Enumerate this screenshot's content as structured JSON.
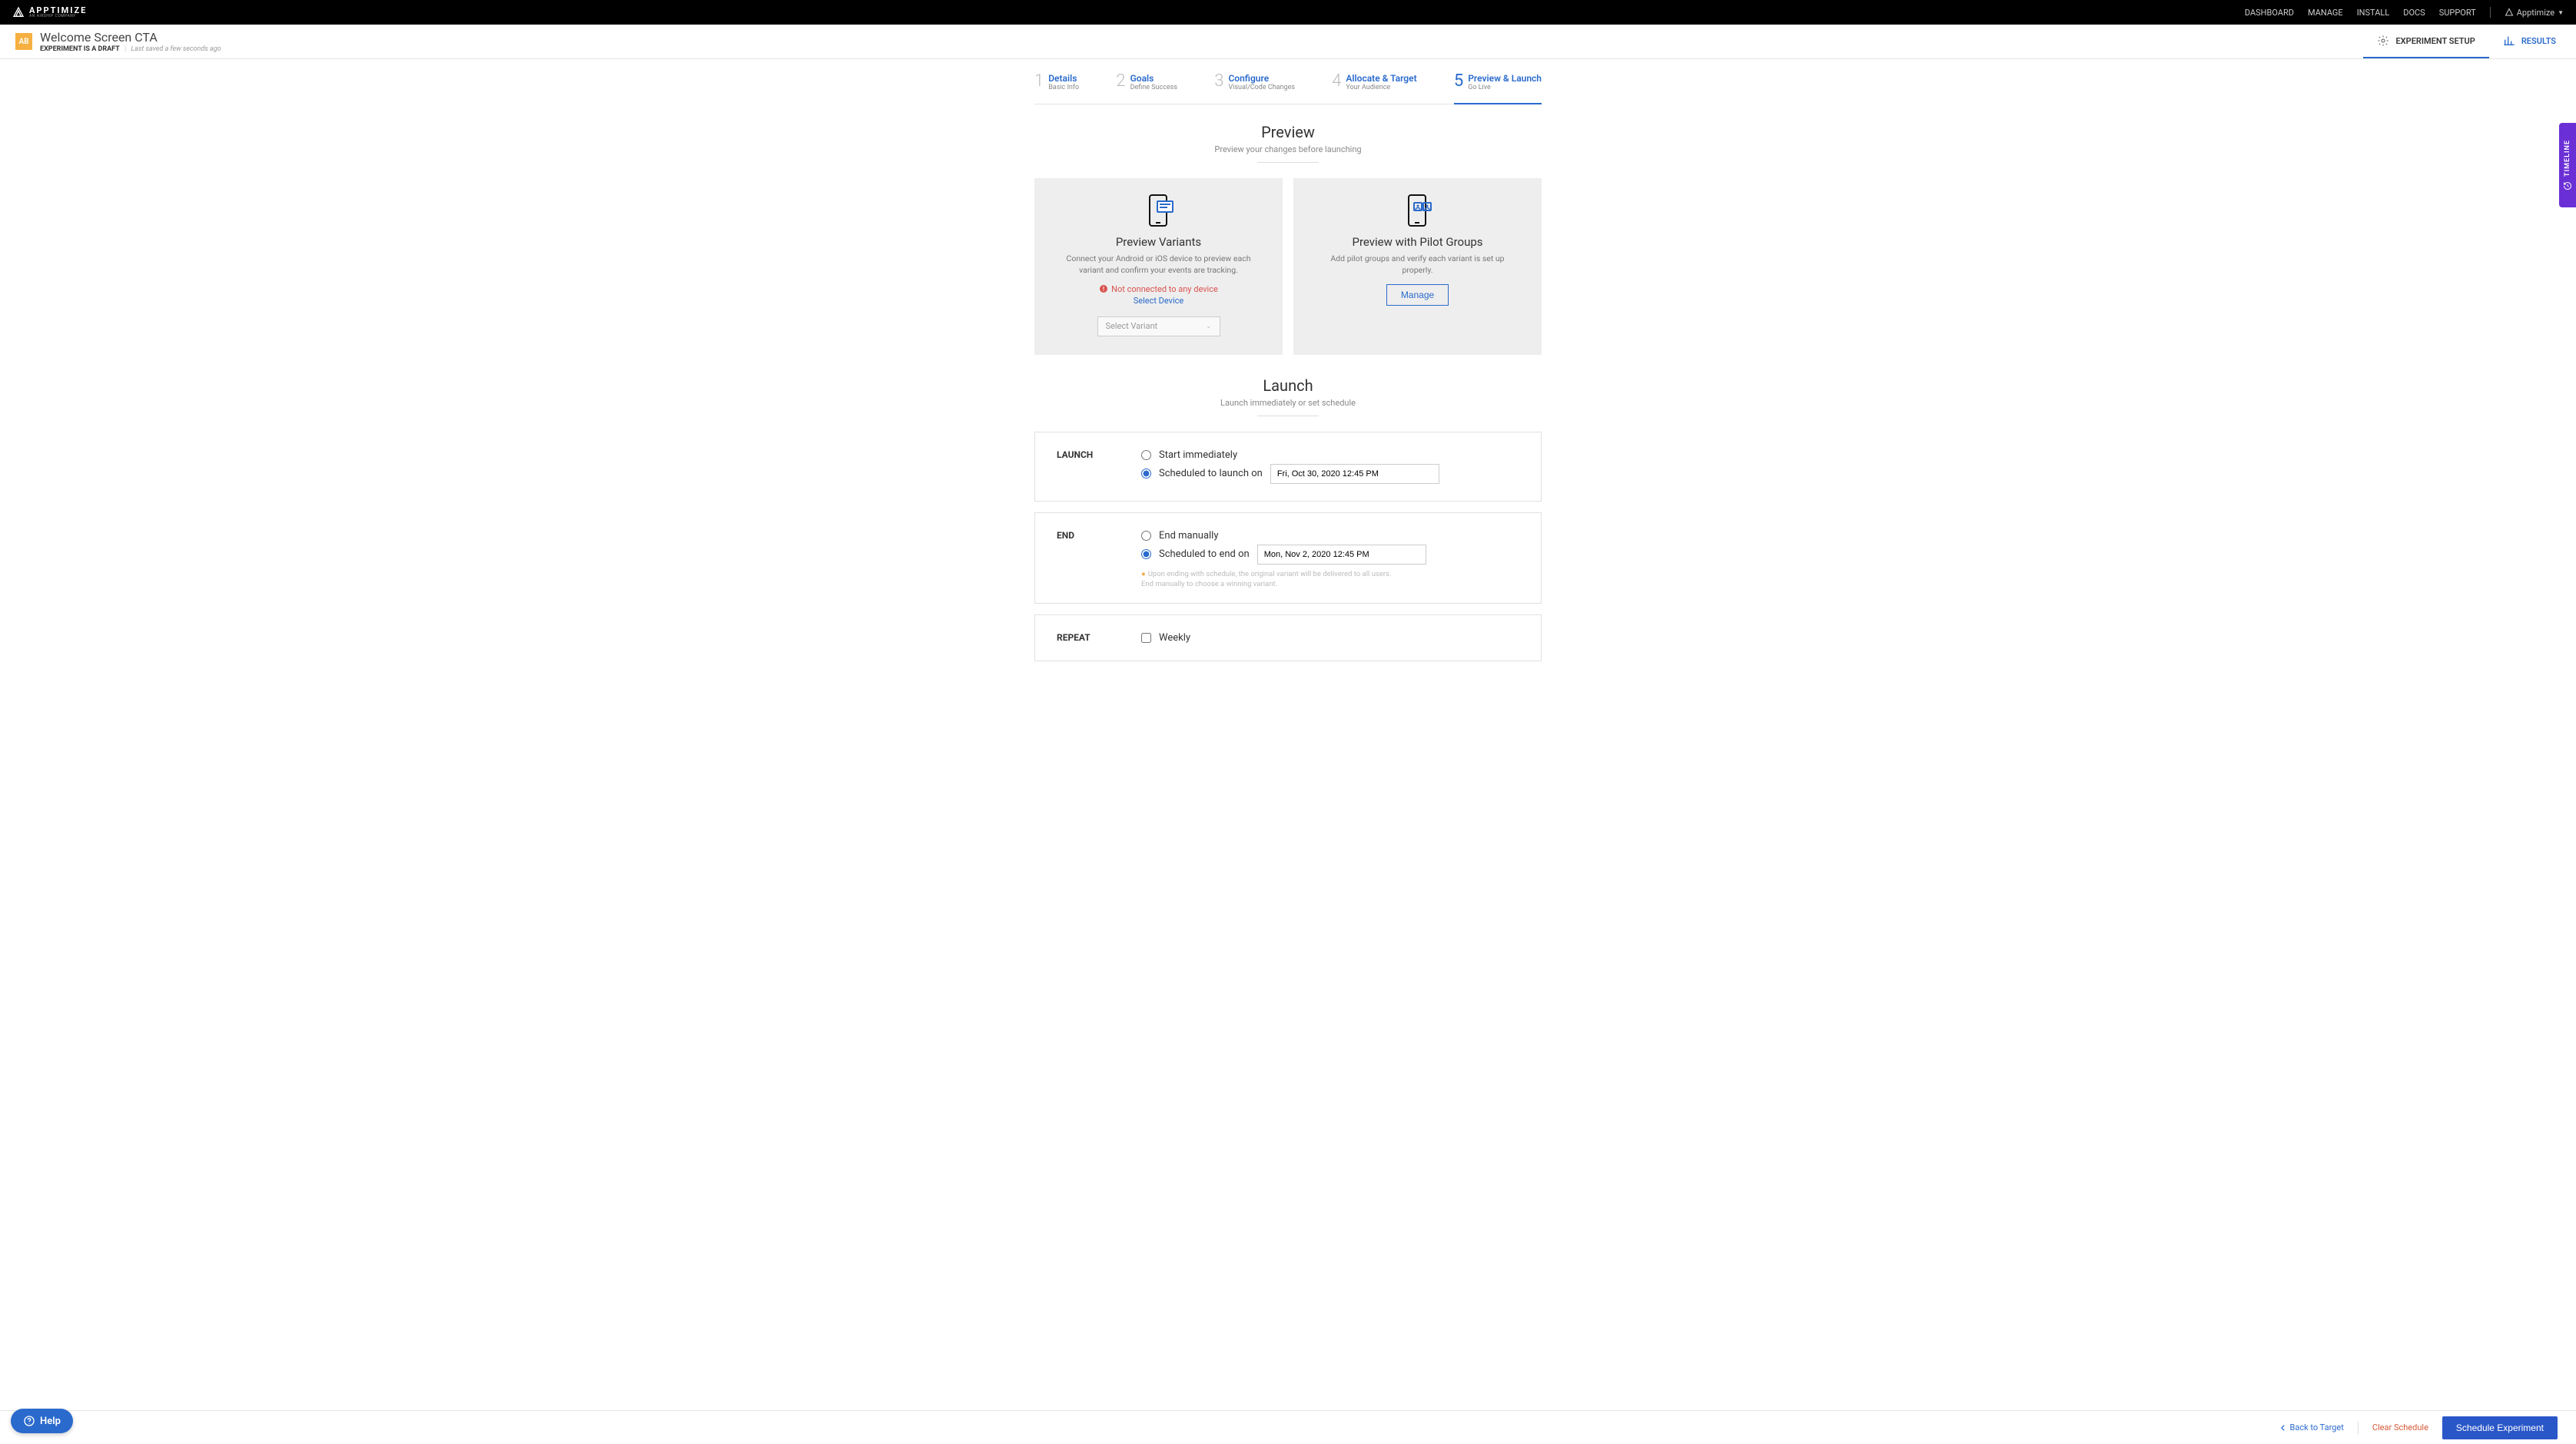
{
  "brand": {
    "name": "APPTIMIZE",
    "tagline": "AN AIRSHIP COMPANY"
  },
  "topnav": {
    "dashboard": "DASHBOARD",
    "manage": "MANAGE",
    "install": "INSTALL",
    "docs": "DOCS",
    "support": "SUPPORT",
    "account": "Apptimize"
  },
  "experiment": {
    "badge": "AB",
    "title": "Welcome Screen CTA",
    "draft_label": "EXPERIMENT IS A DRAFT",
    "saved_label": "Last saved a few seconds ago"
  },
  "subtabs": {
    "setup": "EXPERIMENT SETUP",
    "results": "RESULTS"
  },
  "steps": [
    {
      "num": "1",
      "title": "Details",
      "sub": "Basic Info"
    },
    {
      "num": "2",
      "title": "Goals",
      "sub": "Define Success"
    },
    {
      "num": "3",
      "title": "Configure",
      "sub": "Visual/Code Changes"
    },
    {
      "num": "4",
      "title": "Allocate & Target",
      "sub": "Your Audience"
    },
    {
      "num": "5",
      "title": "Preview & Launch",
      "sub": "Go Live"
    }
  ],
  "preview_section": {
    "heading": "Preview",
    "subheading": "Preview your changes before launching",
    "variants_card": {
      "title": "Preview Variants",
      "desc": "Connect your Android or iOS device to preview each variant and confirm your events are tracking.",
      "warn": "Not connected to any device",
      "select_device": "Select Device",
      "select_variant_placeholder": "Select Variant"
    },
    "pilot_card": {
      "title": "Preview with Pilot Groups",
      "desc": "Add pilot groups and verify each variant is set up properly.",
      "manage": "Manage"
    }
  },
  "launch_section": {
    "heading": "Launch",
    "subheading": "Launch immediately or set schedule",
    "launch_panel": {
      "label": "LAUNCH",
      "start_immediately": "Start immediately",
      "scheduled": "Scheduled to launch on",
      "date": "Fri, Oct 30, 2020 12:45 PM"
    },
    "end_panel": {
      "label": "END",
      "end_manually": "End manually",
      "scheduled": "Scheduled to end on",
      "date": "Mon, Nov 2, 2020 12:45 PM",
      "note_line1": "Upon ending with schedule, the original variant will be delivered to all users.",
      "note_line2": "End manually to choose a winning variant."
    },
    "repeat_panel": {
      "label": "REPEAT",
      "weekly": "Weekly"
    }
  },
  "footer": {
    "back": "Back to Target",
    "clear": "Clear Schedule",
    "primary": "Schedule Experiment"
  },
  "help": "Help",
  "timeline": "TIMELINE"
}
